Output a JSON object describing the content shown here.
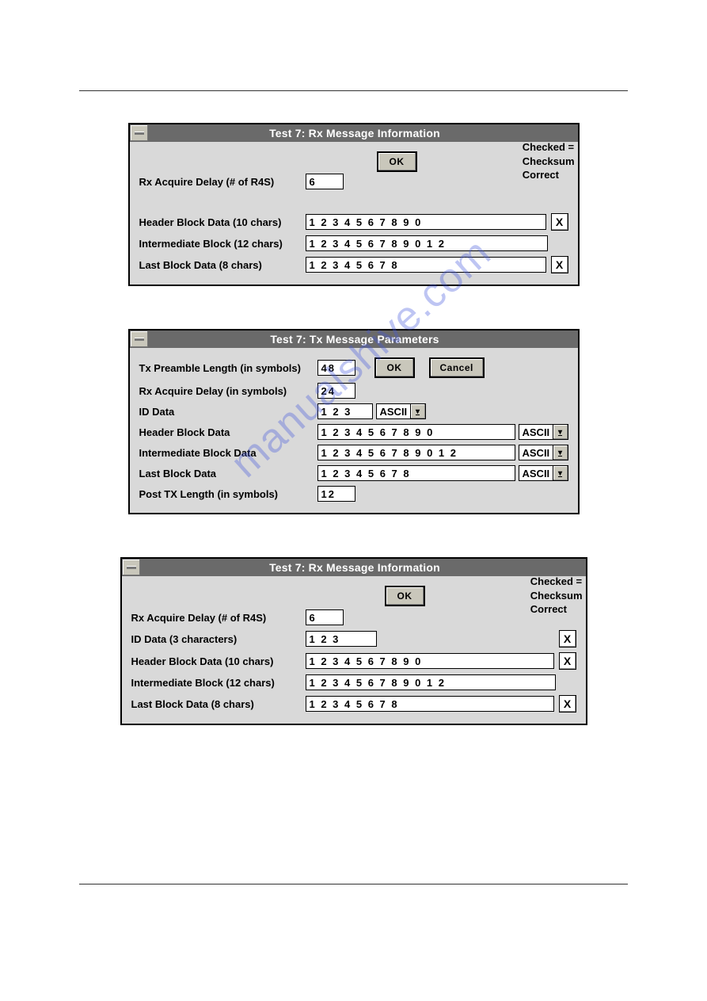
{
  "watermark": "manualshive.com",
  "dialogs": [
    {
      "title": "Test 7: Rx Message Information",
      "ok_label": "OK",
      "checked_legend_line1": "Checked =",
      "checked_legend_line2": "Checksum",
      "checked_legend_line3": "Correct",
      "rows": [
        {
          "label": "Rx Acquire Delay (# of R4S)",
          "value": "6"
        },
        {
          "label": "Header Block Data (10 chars)",
          "value": "1 2 3 4 5 6 7 8 9 0",
          "check": "X"
        },
        {
          "label": "Intermediate Block (12 chars)",
          "value": "1 2 3 4 5 6 7 8 9 0 1 2"
        },
        {
          "label": "Last Block Data (8 chars)",
          "value": "1 2 3 4 5 6 7 8",
          "check": "X"
        }
      ]
    },
    {
      "title": "Test 7: Tx Message Parameters",
      "ok_label": "OK",
      "cancel_label": "Cancel",
      "rows": [
        {
          "label": "Tx Preamble Length (in symbols)",
          "value": "48"
        },
        {
          "label": "Rx Acquire Delay (in symbols)",
          "value": "24"
        },
        {
          "label": "ID Data",
          "value": "1 2 3",
          "encoding": "ASCII"
        },
        {
          "label": "Header Block Data",
          "value": "1 2 3 4 5 6 7 8 9 0",
          "encoding": "ASCII"
        },
        {
          "label": "Intermediate Block Data",
          "value": "1 2 3 4 5 6 7 8 9 0 1 2",
          "encoding": "ASCII"
        },
        {
          "label": "Last Block Data",
          "value": "1 2 3 4 5 6 7 8",
          "encoding": "ASCII"
        },
        {
          "label": "Post TX Length (in symbols)",
          "value": "12"
        }
      ]
    },
    {
      "title": "Test 7: Rx Message Information",
      "ok_label": "OK",
      "checked_legend_line1": "Checked =",
      "checked_legend_line2": "Checksum",
      "checked_legend_line3": "Correct",
      "rows": [
        {
          "label": "Rx Acquire Delay (# of R4S)",
          "value": "6"
        },
        {
          "label": "ID Data (3 characters)",
          "value": "1 2 3",
          "check": "X"
        },
        {
          "label": "Header Block Data (10 chars)",
          "value": "1 2 3 4 5 6 7 8 9 0",
          "check": "X"
        },
        {
          "label": "Intermediate Block (12 chars)",
          "value": "1 2 3 4 5 6 7 8 9 0 1 2"
        },
        {
          "label": "Last Block Data (8 chars)",
          "value": "1 2 3 4 5 6 7 8",
          "check": "X"
        }
      ]
    }
  ]
}
